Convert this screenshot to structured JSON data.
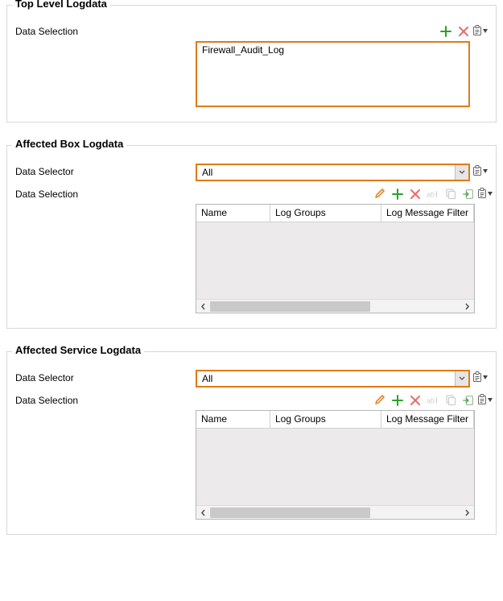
{
  "colors": {
    "accent": "#e17a19",
    "plus": "#2aa12a",
    "cross": "#e86b6b",
    "pencil": "#e18a2b",
    "disabled": "#cfcfcf"
  },
  "sections": {
    "top": {
      "title": "Top Level Logdata",
      "data_selection_label": "Data Selection",
      "items": [
        "Firewall_Audit_Log"
      ]
    },
    "box": {
      "title": "Affected Box Logdata",
      "data_selector_label": "Data Selector",
      "data_selector_value": "All",
      "data_selection_label": "Data Selection",
      "columns": [
        "Name",
        "Log Groups",
        "Log Message Filter"
      ]
    },
    "service": {
      "title": "Affected Service Logdata",
      "data_selector_label": "Data Selector",
      "data_selector_value": "All",
      "data_selection_label": "Data Selection",
      "columns": [
        "Name",
        "Log Groups",
        "Log Message Filter"
      ]
    }
  }
}
